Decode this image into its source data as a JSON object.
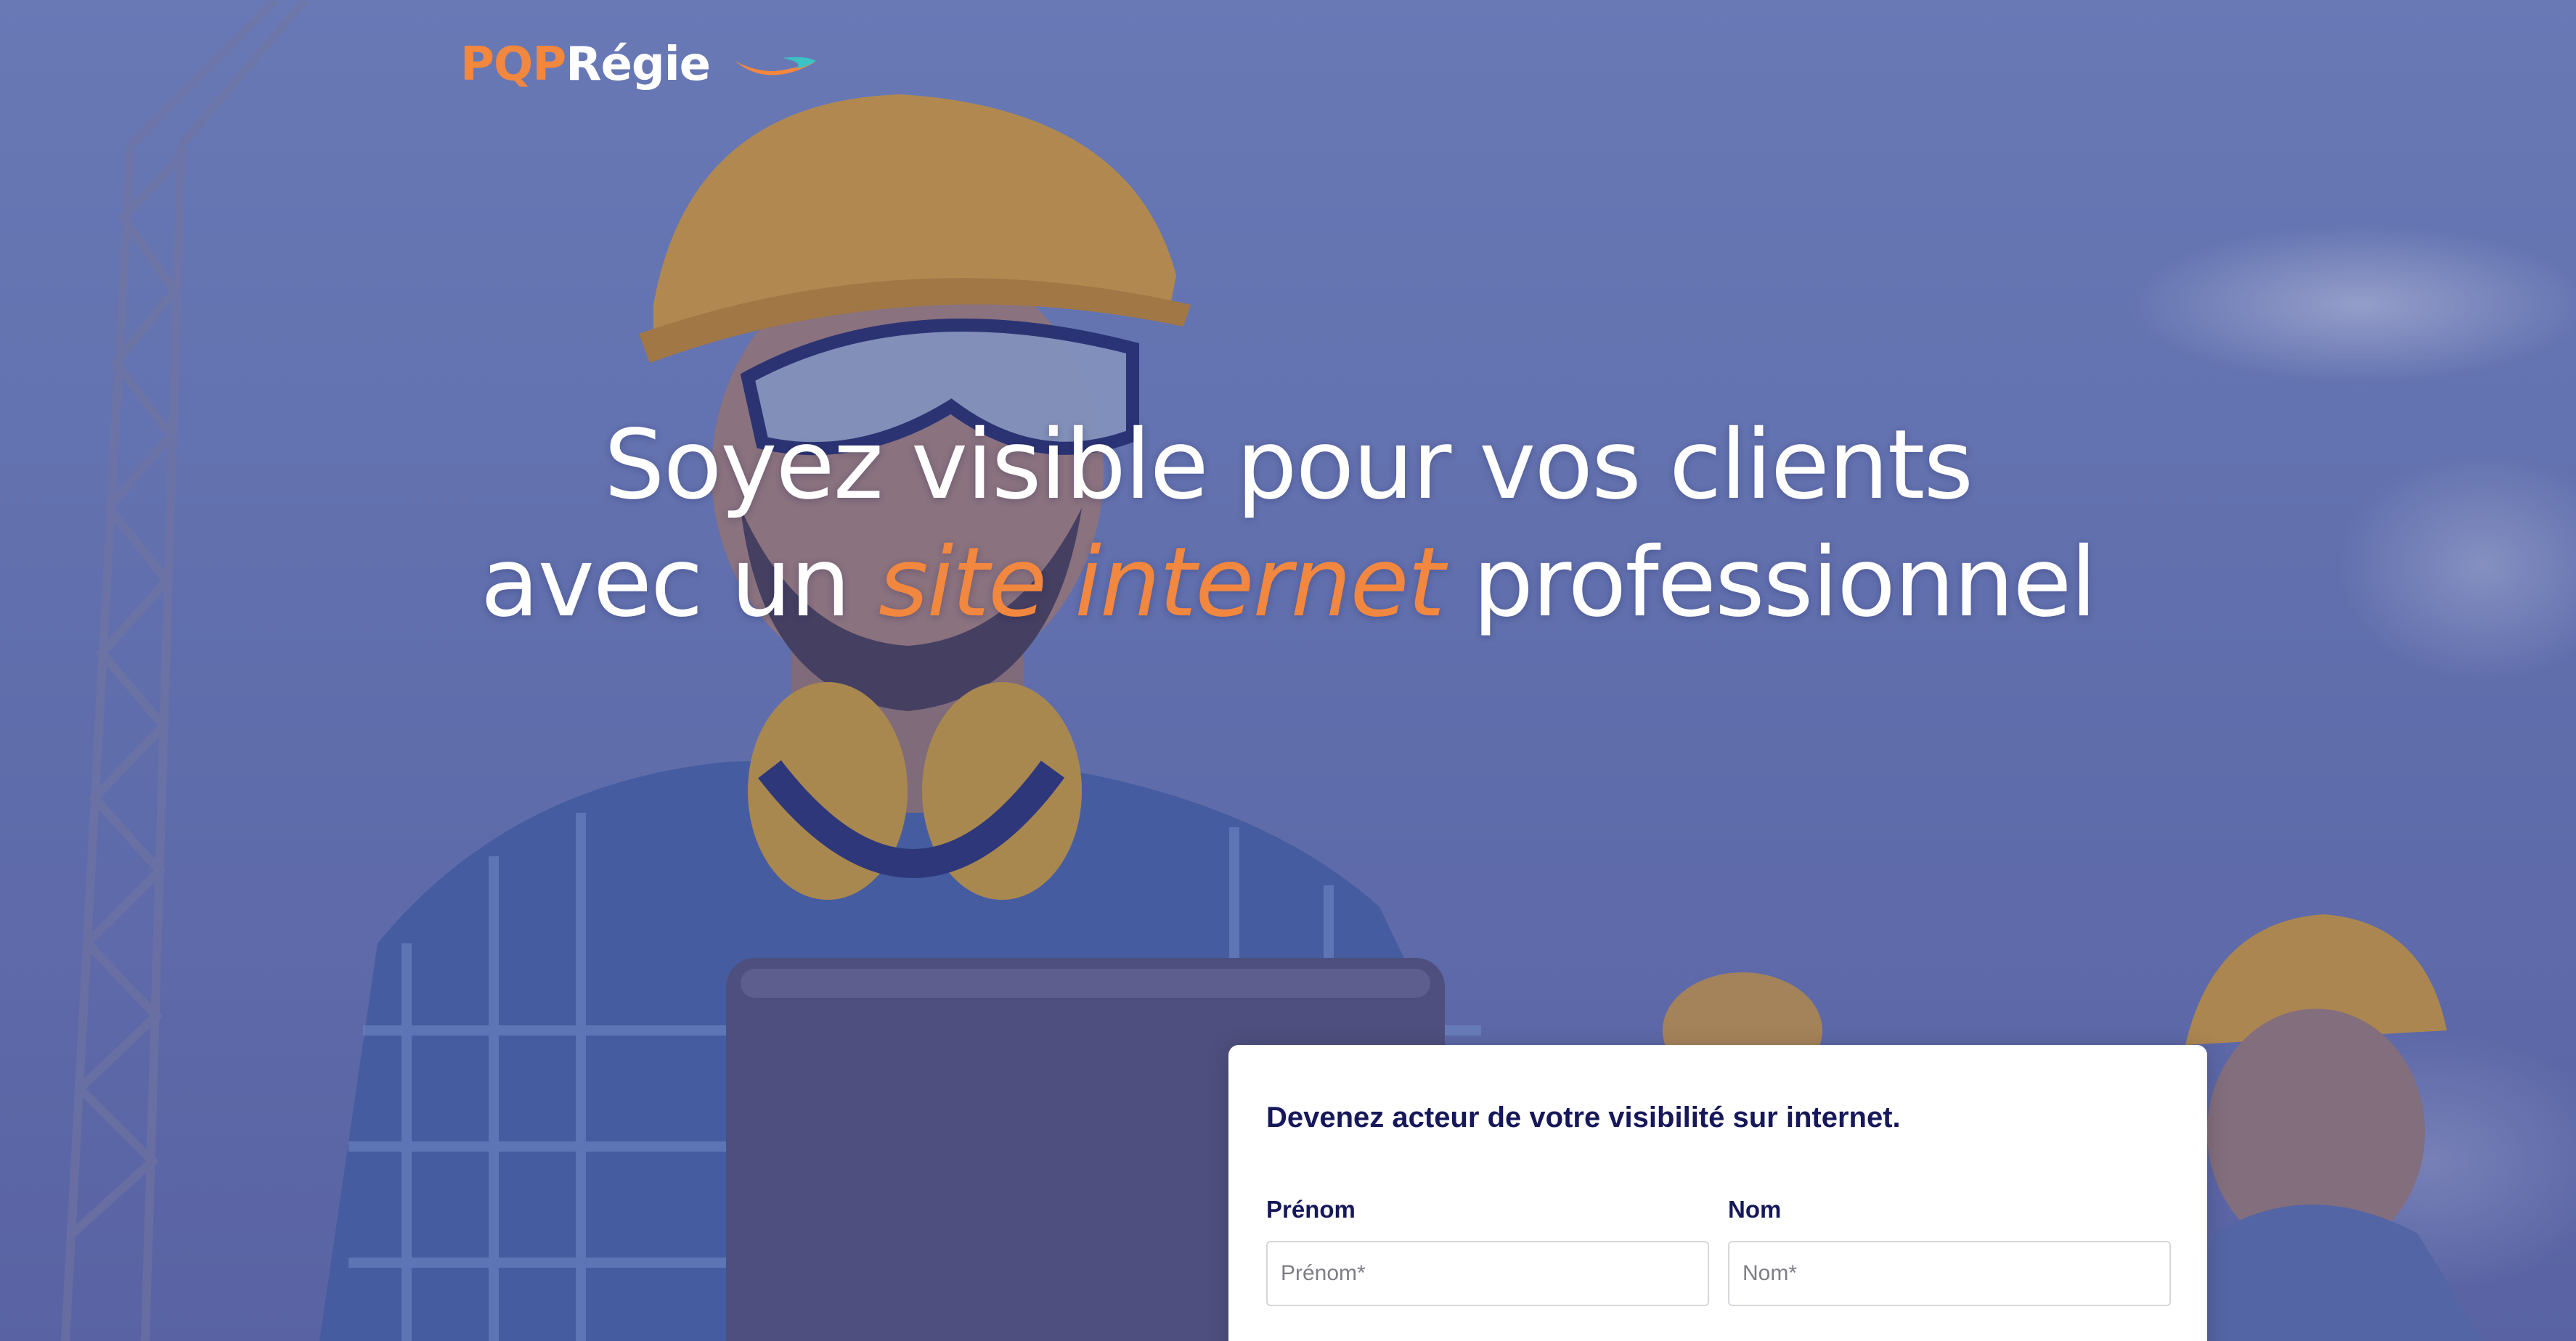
{
  "brand": {
    "logo_part1": "PQP",
    "logo_part2": "Régie",
    "accent_color": "#f2873f",
    "navy_color": "#16185a"
  },
  "hero": {
    "line1": "Soyez visible pour vos clients",
    "line2_prefix": "avec un ",
    "line2_highlight": "site internet",
    "line2_suffix": " professionnel"
  },
  "form": {
    "title": "Devenez acteur de votre visibilité sur internet.",
    "fields": [
      {
        "label": "Prénom",
        "placeholder": "Prénom*",
        "value": ""
      },
      {
        "label": "Nom",
        "placeholder": "Nom*",
        "value": ""
      }
    ]
  }
}
